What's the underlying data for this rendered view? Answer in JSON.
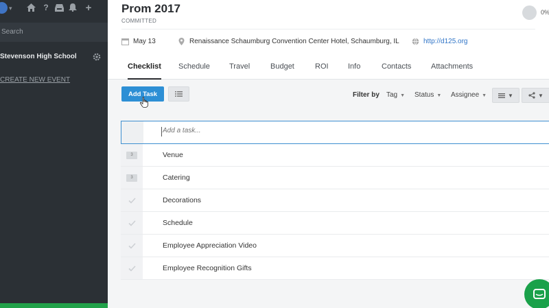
{
  "sidebar": {
    "search_label": "Search",
    "school_name": "Stevenson High School",
    "create_event": "CREATE NEW EVENT"
  },
  "event": {
    "title": "Prom 2017",
    "status": "COMMITTED",
    "progress": "0%",
    "date": "May 13",
    "location": "Renaissance Schaumburg Convention Center Hotel, Schaumburg, IL",
    "website": "http://d125.org"
  },
  "tabs": [
    {
      "label": "Checklist",
      "active": true
    },
    {
      "label": "Schedule"
    },
    {
      "label": "Travel"
    },
    {
      "label": "Budget"
    },
    {
      "label": "ROI"
    },
    {
      "label": "Info"
    },
    {
      "label": "Contacts"
    },
    {
      "label": "Attachments"
    }
  ],
  "toolbar": {
    "add_task": "Add Task",
    "filter_by": "Filter by",
    "filters": [
      "Tag",
      "Status",
      "Assignee"
    ]
  },
  "task_input": {
    "placeholder": "Add a task..."
  },
  "tasks": [
    {
      "label": "Venue",
      "type": "folder",
      "count": "3"
    },
    {
      "label": "Catering",
      "type": "folder",
      "count": "3"
    },
    {
      "label": "Decorations",
      "type": "check"
    },
    {
      "label": "Schedule",
      "type": "check"
    },
    {
      "label": "Employee Appreciation Video",
      "type": "check"
    },
    {
      "label": "Employee Recognition Gifts",
      "type": "check"
    }
  ],
  "colors": {
    "sidebar": "#2b3035",
    "accent": "#2d8fd5",
    "chat": "#1aa14a"
  }
}
